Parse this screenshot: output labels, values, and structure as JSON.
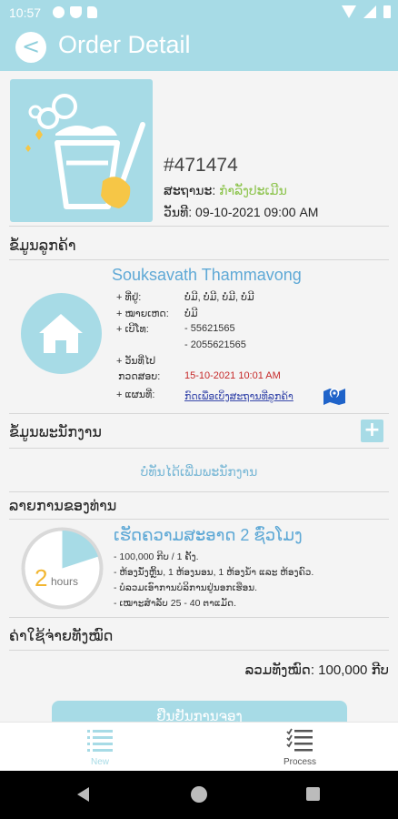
{
  "status_bar": {
    "time": "10:57",
    "icons": [
      "gear-icon",
      "shield-icon",
      "sd-card-icon",
      "wifi-icon",
      "signal-icon",
      "battery-icon"
    ]
  },
  "app_bar": {
    "title": "Order Detail",
    "back_icon": "<"
  },
  "order": {
    "id": "#471474",
    "status_label": "ສະຖານະ:",
    "status_value": "ກຳລັງປະເມີນ",
    "date_label": "ວັນທີ:",
    "date_value": "09-10-2021 09:00 AM"
  },
  "customer": {
    "section_title": "ຂໍ້ມູນລູກຄ້າ",
    "name": "Souksavath Thammavong",
    "address_label": "+ ທີ່ຢູ່:",
    "address_value": "ບໍ່ມີ, ບໍ່ມີ, ບໍ່ມີ, ບໍ່ມີ",
    "note_label": "+ ໝາຍເຫດ:",
    "note_value": "ບໍ່ມີ",
    "phone_label": "+ ເບີໂທ:",
    "phone_1": "- 55621565",
    "phone_2": "- 2055621565",
    "deadline_label_1": "+ ວັນທີ່ໄປ",
    "deadline_label_2": "ກວດສອບ:",
    "deadline_value": "15-10-2021 10:01 AM",
    "map_label": "+ ແຜນທີ່:",
    "map_link": "ກົດເພື່ອເບິ່ງສະຖານທີ່ລູກຄ້າ"
  },
  "employee": {
    "section_title": "ຂໍ້ມູນພະນັກງານ",
    "empty_text": "ບໍ່ທັນໄດ້ເພີ່ມພະນັກງານ"
  },
  "services": {
    "section_title": "ລາຍການຂອງທ່ານ",
    "duration_number": "2",
    "duration_unit": "hours",
    "duration_fraction": 0.2,
    "name": "ເຮັດຄວາມສະອາດ 2 ຊົ່ວໂມງ",
    "lines": [
      "- 100,000 ກີບ / 1 ຄັ້ງ.",
      "- ຫ້ອງນັ່ງຫຼິ້ນ, 1 ຫ້ອງນອນ, 1 ຫ້ອງນ້ຳ ແລະ ຫ້ອງຄົວ.",
      "- ບໍ່ລວມເອົາການບໍລິການຢູ່ນອກເຮືອນ.",
      "- ເໝາະສຳລັບ 25 - 40 ຕາແມັດ."
    ]
  },
  "totals": {
    "section_title": "ຄ່າໃຊ້ຈ່າຍທັງໝົດ",
    "total_text": "ລວມທັງໝົດ: 100,000 ກີບ"
  },
  "action_button": {
    "label": "ຢືນຢັນການຈອງ"
  },
  "bottom_nav": [
    {
      "label": "New",
      "icon": "list-icon",
      "active": true
    },
    {
      "label": "Process",
      "icon": "checklist-icon",
      "active": false
    }
  ],
  "colors": {
    "primary": "#a7dbe6",
    "accent_text": "#5fa9d6",
    "status_green": "#8bc34a",
    "deadline_red": "#c62828"
  }
}
